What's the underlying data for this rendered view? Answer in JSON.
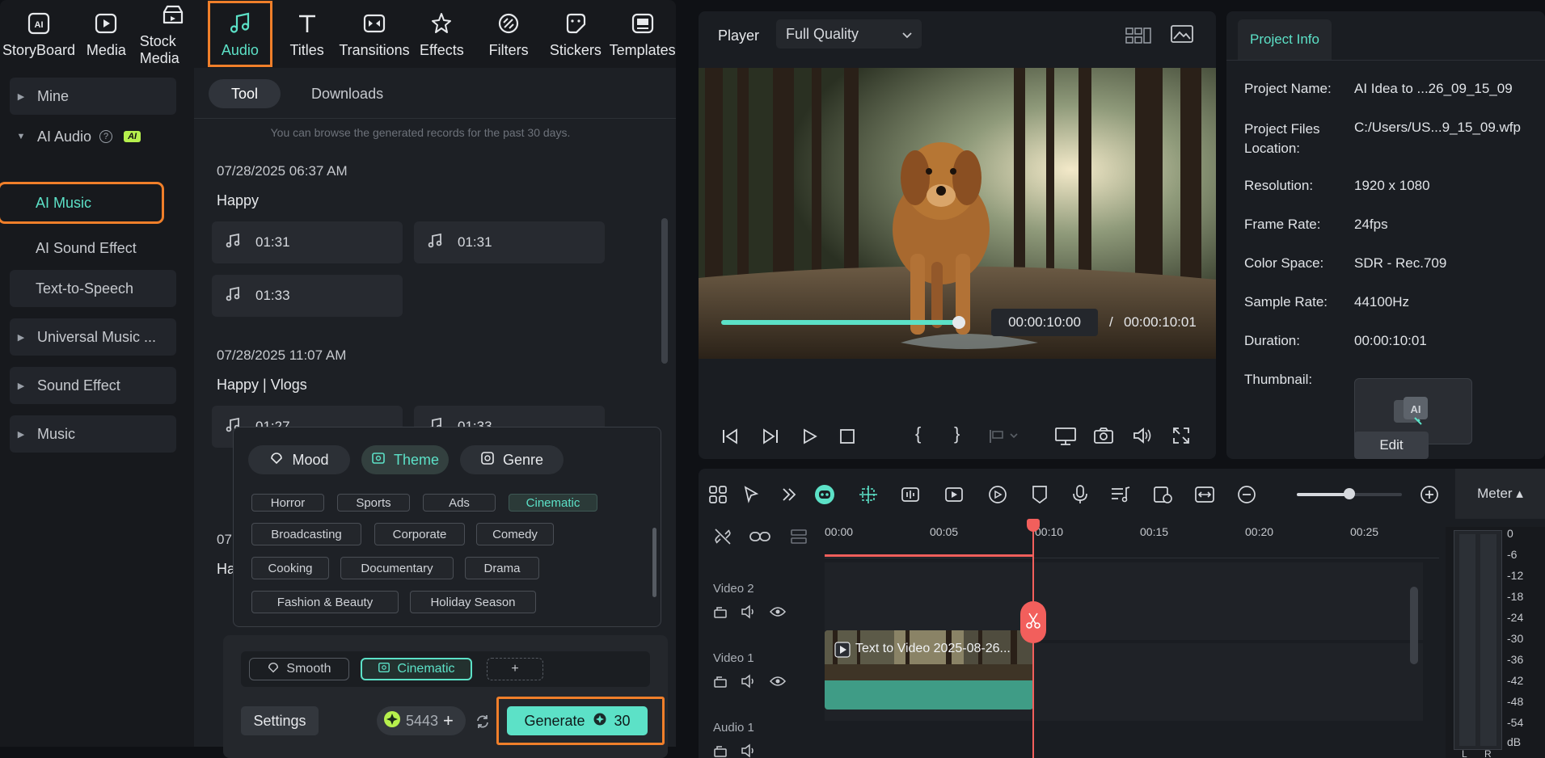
{
  "toolbar": {
    "items": [
      {
        "label": "StoryBoard",
        "icon": "ai-storyboard-icon"
      },
      {
        "label": "Media",
        "icon": "media-icon"
      },
      {
        "label": "Stock Media",
        "icon": "stock-media-icon"
      },
      {
        "label": "Audio",
        "icon": "music-note-icon",
        "active": true
      },
      {
        "label": "Titles",
        "icon": "titles-icon"
      },
      {
        "label": "Transitions",
        "icon": "transitions-icon"
      },
      {
        "label": "Effects",
        "icon": "effects-icon"
      },
      {
        "label": "Filters",
        "icon": "filters-icon"
      },
      {
        "label": "Stickers",
        "icon": "stickers-icon"
      },
      {
        "label": "Templates",
        "icon": "templates-icon"
      }
    ]
  },
  "sidebar": {
    "mine": "Mine",
    "ai_audio": "AI Audio",
    "ai_badge": "AI",
    "help": "?",
    "ai_music": "AI Music",
    "ai_sound_effect": "AI Sound Effect",
    "text_to_speech": "Text-to-Speech",
    "universal_music": "Universal Music ...",
    "sound_effect": "Sound Effect",
    "music": "Music"
  },
  "content": {
    "tab_tool": "Tool",
    "tab_downloads": "Downloads",
    "hint": "You can browse the generated records for the past 30 days.",
    "group1": {
      "date": "07/28/2025 06:37 AM",
      "title": "Happy",
      "tracks": [
        "01:31",
        "01:31",
        "01:33"
      ]
    },
    "group2": {
      "date": "07/28/2025 11:07 AM",
      "title": "Happy | Vlogs",
      "tracks": [
        "01:27",
        "01:33"
      ]
    },
    "group3": {
      "date_partial": "07",
      "title_partial": "Ha"
    }
  },
  "popup": {
    "tab_mood": "Mood",
    "tab_theme": "Theme",
    "tab_genre": "Genre",
    "chips": [
      "Horror",
      "Sports",
      "Ads",
      "Cinematic",
      "Broadcasting",
      "Corporate",
      "Comedy",
      "Cooking",
      "Documentary",
      "Drama",
      "Fashion & Beauty",
      "Holiday Season"
    ],
    "selected_chip": "Cinematic"
  },
  "bottom": {
    "tag_smooth": "Smooth",
    "tag_cinematic": "Cinematic",
    "tag_add": "+",
    "settings": "Settings",
    "credits": "5443",
    "credits_plus": "+",
    "generate": "Generate",
    "generate_cost": "30"
  },
  "player": {
    "label": "Player",
    "quality": "Full Quality",
    "current_time": "00:00:10:00",
    "separator": "/",
    "total_time": "00:00:10:01",
    "progress": 0.98,
    "brace_open": "{",
    "brace_close": "}"
  },
  "info": {
    "tab": "Project Info",
    "rows": [
      {
        "label": "Project Name:",
        "value": "AI Idea to ...26_09_15_09"
      },
      {
        "label": "Project Files Location:",
        "value": "C:/Users/US...9_15_09.wfp"
      },
      {
        "label": "Resolution:",
        "value": "1920 x 1080"
      },
      {
        "label": "Frame Rate:",
        "value": "24fps"
      },
      {
        "label": "Color Space:",
        "value": "SDR - Rec.709"
      },
      {
        "label": "Sample Rate:",
        "value": "44100Hz"
      },
      {
        "label": "Duration:",
        "value": "00:00:10:01"
      }
    ],
    "thumbnail_label": "Thumbnail:",
    "edit": "Edit"
  },
  "timeline": {
    "meter": "Meter ▴",
    "ruler": [
      "00:00",
      "00:05",
      "00:10",
      "00:15",
      "00:20",
      "00:25"
    ],
    "tracks": [
      "Video 2",
      "Video 1",
      "Audio 1"
    ],
    "clip_title": "Text to Video 2025-08-26...",
    "meter_scale": [
      "0",
      "-6",
      "-12",
      "-18",
      "-24",
      "-30",
      "-36",
      "-42",
      "-48",
      "-54",
      "dB"
    ],
    "meter_channels": [
      "L",
      "R"
    ],
    "zoom_level": 0.5
  },
  "colors": {
    "accent": "#5ce1c7",
    "highlight": "#f07f2a",
    "playhead": "#f25f5c"
  }
}
